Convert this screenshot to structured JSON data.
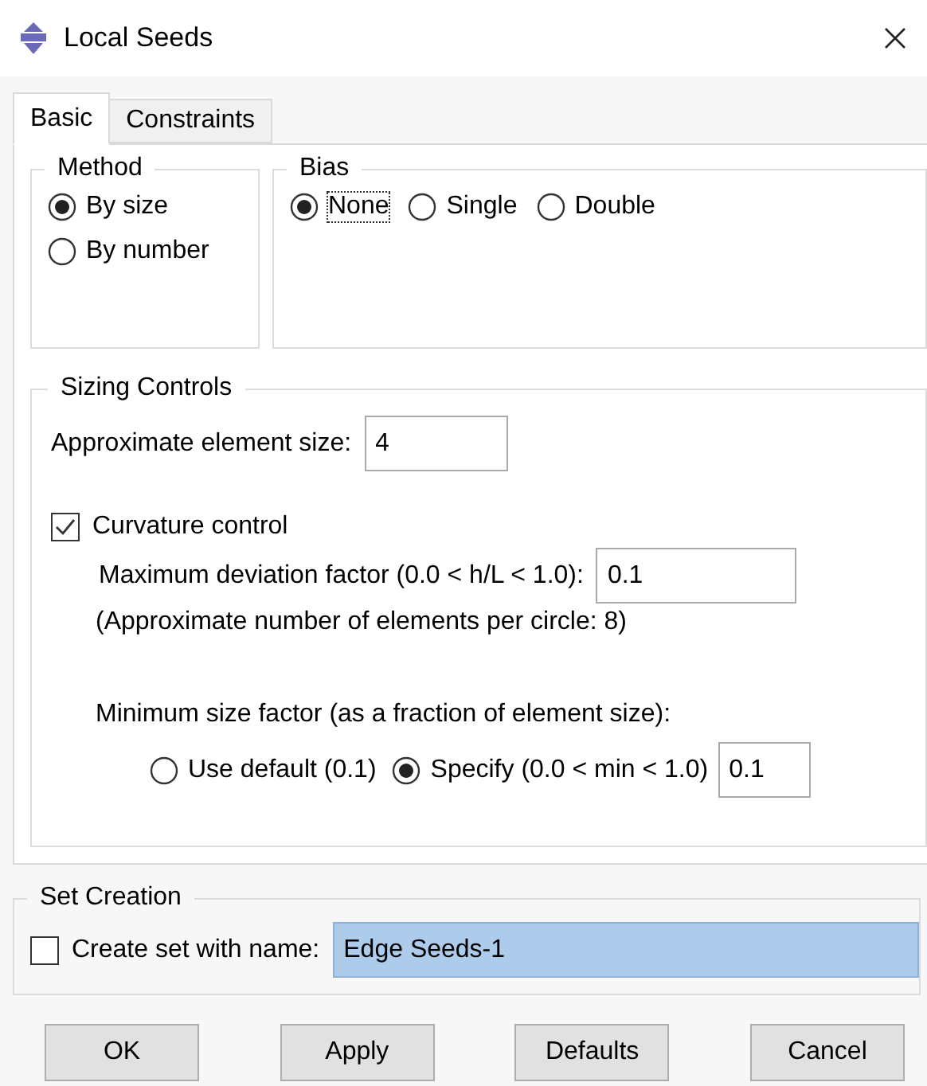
{
  "window": {
    "title": "Local Seeds"
  },
  "tabs": [
    {
      "label": "Basic",
      "selected": true
    },
    {
      "label": "Constraints",
      "selected": false
    }
  ],
  "method": {
    "title": "Method",
    "options": [
      {
        "label": "By size",
        "selected": true
      },
      {
        "label": "By number",
        "selected": false
      }
    ]
  },
  "bias": {
    "title": "Bias",
    "options": [
      {
        "label": "None",
        "selected": true,
        "focused": true
      },
      {
        "label": "Single",
        "selected": false,
        "focused": false
      },
      {
        "label": "Double",
        "selected": false,
        "focused": false
      }
    ]
  },
  "sizing": {
    "title": "Sizing Controls",
    "size_label": "Approximate element size:",
    "size_value": "4",
    "curvature": {
      "label": "Curvature control",
      "checked": true
    },
    "deviation_label": "Maximum deviation factor (0.0 < h/L < 1.0):",
    "deviation_value": "0.1",
    "note": "(Approximate number of elements per circle: 8)",
    "min_label": "Minimum size factor (as a fraction of element size):",
    "min_options": [
      {
        "label": "Use default (0.1)",
        "selected": false
      },
      {
        "label": "Specify (0.0 < min < 1.0)",
        "selected": true
      }
    ],
    "min_value": "0.1"
  },
  "set_creation": {
    "title": "Set Creation",
    "checkbox": {
      "label": "Create set with name:",
      "checked": false
    },
    "name_value": "Edge Seeds-1",
    "highlighted": true
  },
  "buttons": [
    "OK",
    "Apply",
    "Defaults",
    "Cancel"
  ]
}
